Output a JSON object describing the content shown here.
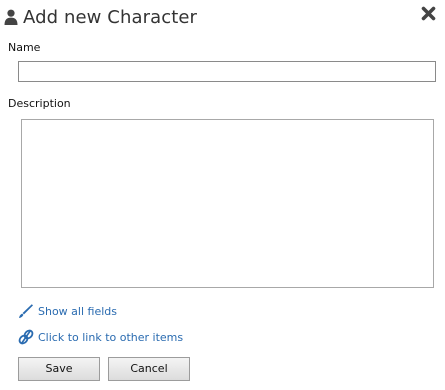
{
  "dialog": {
    "title": "Add new Character",
    "header_icon": "user-icon",
    "close_icon": "close-icon"
  },
  "fields": {
    "name_label": "Name",
    "name_value": "",
    "description_label": "Description",
    "description_value": ""
  },
  "links": {
    "show_all_fields": "Show all fields",
    "show_all_fields_icon": "pencil-icon",
    "link_items": "Click to link to other items",
    "link_items_icon": "link-icon",
    "color": "#2a6bb0"
  },
  "buttons": {
    "save_label": "Save",
    "cancel_label": "Cancel"
  }
}
